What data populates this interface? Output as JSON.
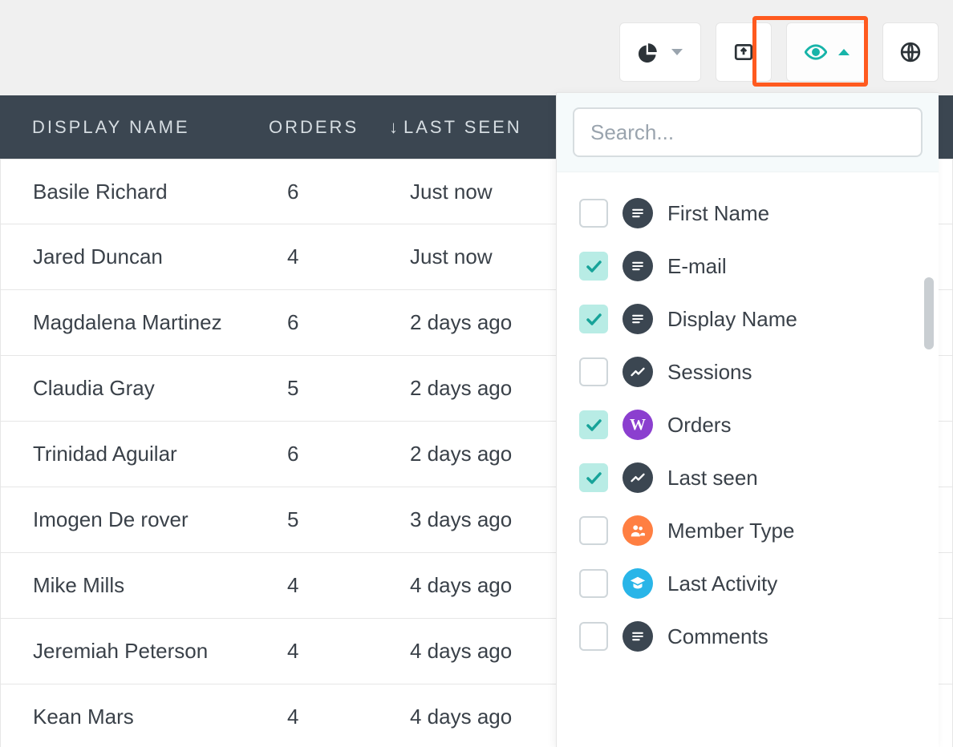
{
  "toolbar": {
    "chart_button": "chart",
    "export_button": "export",
    "visibility_button": "visibility",
    "globe_button": "globe"
  },
  "table": {
    "headers": {
      "display_name": "DISPLAY NAME",
      "orders": "ORDERS",
      "last_seen": "LAST SEEN",
      "sort_indicator": "↓"
    },
    "rows": [
      {
        "name": "Basile Richard",
        "orders": "6",
        "last_seen": "Just now"
      },
      {
        "name": "Jared Duncan",
        "orders": "4",
        "last_seen": "Just now"
      },
      {
        "name": "Magdalena Martinez",
        "orders": "6",
        "last_seen": "2 days ago"
      },
      {
        "name": "Claudia Gray",
        "orders": "5",
        "last_seen": "2 days ago"
      },
      {
        "name": "Trinidad Aguilar",
        "orders": "6",
        "last_seen": "2 days ago"
      },
      {
        "name": "Imogen De rover",
        "orders": "5",
        "last_seen": "3 days ago"
      },
      {
        "name": "Mike Mills",
        "orders": "4",
        "last_seen": "4 days ago"
      },
      {
        "name": "Jeremiah Peterson",
        "orders": "4",
        "last_seen": "4 days ago"
      },
      {
        "name": "Kean Mars",
        "orders": "4",
        "last_seen": "4 days ago"
      }
    ]
  },
  "dropdown": {
    "search_placeholder": "Search...",
    "options": [
      {
        "label": "First Name",
        "checked": false,
        "icon": "text",
        "icon_color": "dark"
      },
      {
        "label": "E-mail",
        "checked": true,
        "icon": "text",
        "icon_color": "dark"
      },
      {
        "label": "Display Name",
        "checked": true,
        "icon": "text",
        "icon_color": "dark"
      },
      {
        "label": "Sessions",
        "checked": false,
        "icon": "trend",
        "icon_color": "dark"
      },
      {
        "label": "Orders",
        "checked": true,
        "icon": "w",
        "icon_color": "purple"
      },
      {
        "label": "Last seen",
        "checked": true,
        "icon": "trend",
        "icon_color": "dark"
      },
      {
        "label": "Member Type",
        "checked": false,
        "icon": "people",
        "icon_color": "orange"
      },
      {
        "label": "Last Activity",
        "checked": false,
        "icon": "school",
        "icon_color": "cyan"
      },
      {
        "label": "Comments",
        "checked": false,
        "icon": "text",
        "icon_color": "dark"
      }
    ]
  }
}
